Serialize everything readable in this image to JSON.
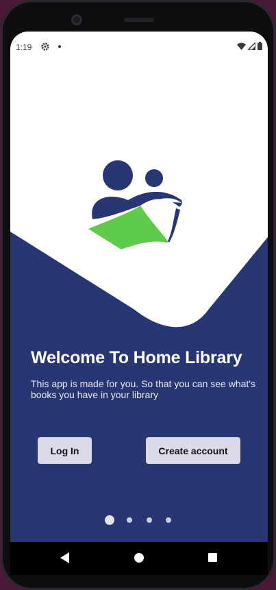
{
  "status_bar": {
    "time": "1:19",
    "icons": [
      "settings-icon",
      "notification-dot",
      "wifi-icon",
      "signal-icon",
      "battery-icon"
    ]
  },
  "welcome": {
    "title": "Welcome To Home Library",
    "subtitle": "This app is made for you. So that you can see what's books you have in your library"
  },
  "buttons": {
    "login": "Log In",
    "create_account": "Create account"
  },
  "pager": {
    "count": 4,
    "active_index": 0
  },
  "nav_bar": {
    "icons": [
      "back-icon",
      "home-icon",
      "recents-icon"
    ]
  },
  "colors": {
    "brand_navy": "#283673",
    "logo_green": "#5ecb4a",
    "button_bg": "#dcd9e8",
    "screen_white": "#ffffff"
  }
}
